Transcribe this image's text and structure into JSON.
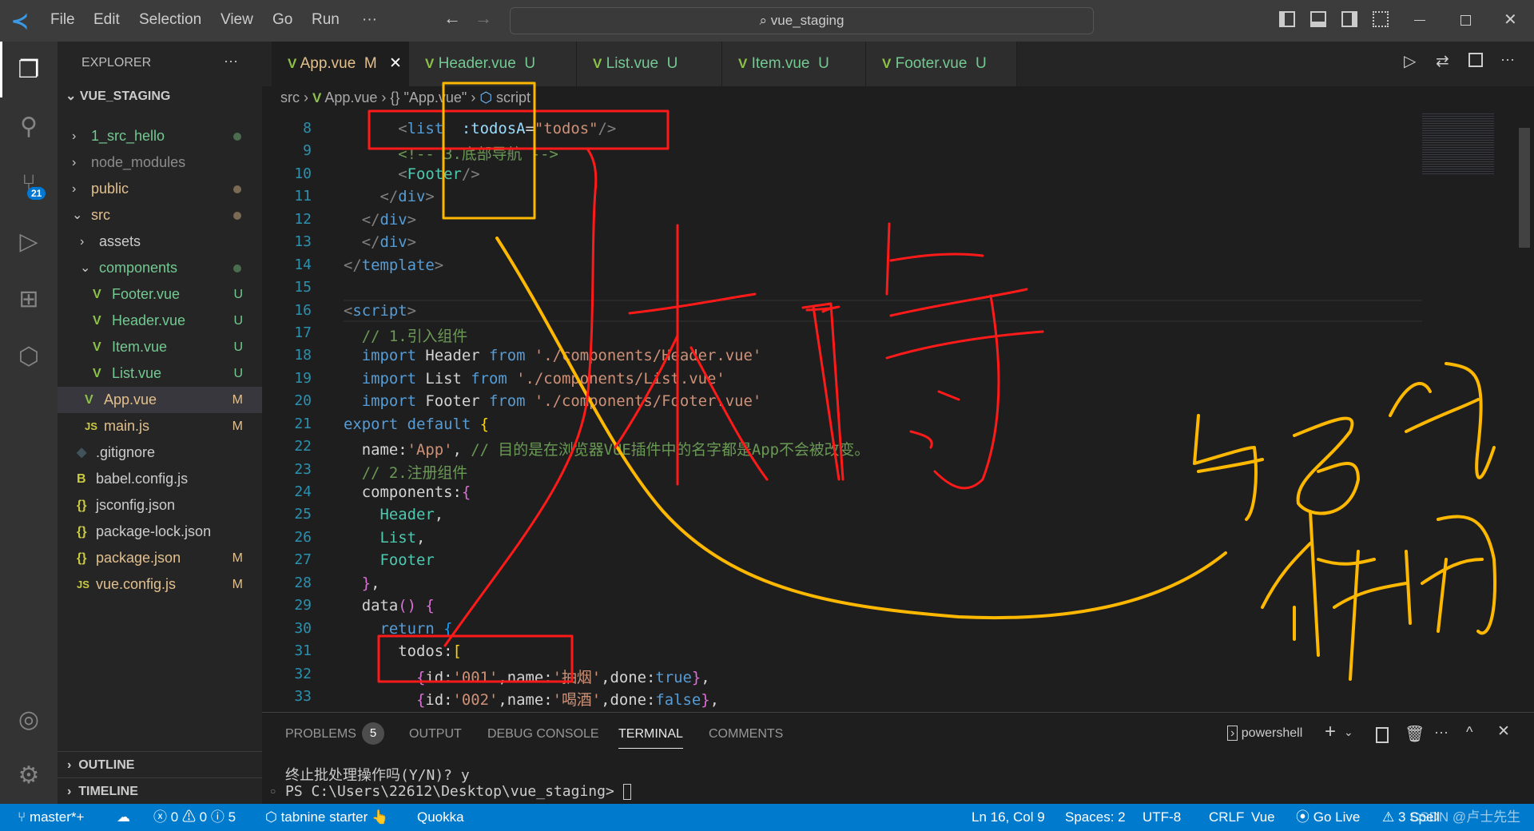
{
  "titlebar": {
    "menu": [
      "File",
      "Edit",
      "Selection",
      "View",
      "Go",
      "Run",
      "···"
    ],
    "search": "vue_staging",
    "back": "←",
    "forward": "→"
  },
  "activity": {
    "scm_badge": "21"
  },
  "sidebar": {
    "title": "EXPLORER",
    "more": "···",
    "root": "VUE_STAGING",
    "items": [
      {
        "label": "1_src_hello",
        "chev": "›",
        "depth": 0,
        "color": "#73c991",
        "dot": "#4b6c4f",
        "status": ""
      },
      {
        "label": "node_modules",
        "chev": "›",
        "depth": 0,
        "color": "#8c8c8c",
        "dot": "",
        "status": ""
      },
      {
        "label": "public",
        "chev": "›",
        "depth": 0,
        "color": "#e2c08d",
        "dot": "#7a6a53",
        "status": ""
      },
      {
        "label": "src",
        "chev": "⌄",
        "depth": 0,
        "color": "#e2c08d",
        "dot": "#7a6a53",
        "status": ""
      },
      {
        "label": "assets",
        "chev": "›",
        "depth": 1,
        "color": "#cccccc",
        "dot": "",
        "status": ""
      },
      {
        "label": "components",
        "chev": "⌄",
        "depth": 1,
        "color": "#73c991",
        "dot": "#4b6c4f",
        "status": ""
      },
      {
        "label": "Footer.vue",
        "icon": "V",
        "depth": 2,
        "color": "#73c991",
        "status": "U"
      },
      {
        "label": "Header.vue",
        "icon": "V",
        "depth": 2,
        "color": "#73c991",
        "status": "U"
      },
      {
        "label": "Item.vue",
        "icon": "V",
        "depth": 2,
        "color": "#73c991",
        "status": "U"
      },
      {
        "label": "List.vue",
        "icon": "V",
        "depth": 2,
        "color": "#73c991",
        "status": "U"
      },
      {
        "label": "App.vue",
        "icon": "V",
        "depth": 1,
        "color": "#e2c08d",
        "status": "M",
        "selected": true
      },
      {
        "label": "main.js",
        "icon": "JS",
        "depth": 1,
        "color": "#e2c08d",
        "status": "M"
      },
      {
        "label": ".gitignore",
        "icon": "◆",
        "depth": 0,
        "color": "#cccccc",
        "status": ""
      },
      {
        "label": "babel.config.js",
        "icon": "B",
        "depth": 0,
        "color": "#cccccc",
        "status": ""
      },
      {
        "label": "jsconfig.json",
        "icon": "{}",
        "depth": 0,
        "color": "#cccccc",
        "status": ""
      },
      {
        "label": "package-lock.json",
        "icon": "{}",
        "depth": 0,
        "color": "#cccccc",
        "status": ""
      },
      {
        "label": "package.json",
        "icon": "{}",
        "depth": 0,
        "color": "#e2c08d",
        "status": "M"
      },
      {
        "label": "vue.config.js",
        "icon": "JS",
        "depth": 0,
        "color": "#e2c08d",
        "status": "M"
      }
    ],
    "outline": "OUTLINE",
    "timeline": "TIMELINE"
  },
  "tabs": [
    {
      "label": "App.vue",
      "status": "M",
      "active": true
    },
    {
      "label": "Header.vue",
      "status": "U"
    },
    {
      "label": "List.vue",
      "status": "U"
    },
    {
      "label": "Item.vue",
      "status": "U"
    },
    {
      "label": "Footer.vue",
      "status": "U"
    }
  ],
  "breadcrumb": [
    "src",
    "App.vue",
    "\"App.vue\"",
    "script"
  ],
  "editor": {
    "first_line": 8,
    "lines": [
      [
        [
          "      ",
          "t-txt"
        ],
        [
          "<",
          "t-tag"
        ],
        [
          "list",
          "t-name"
        ],
        [
          "  :todosA",
          "t-attr"
        ],
        [
          "=",
          "t-txt"
        ],
        [
          "\"todos\"",
          "t-str"
        ],
        [
          "/>",
          "t-tag"
        ]
      ],
      [
        [
          "      ",
          "t-txt"
        ],
        [
          "<!-- 3.底部导航 -->",
          "t-com"
        ]
      ],
      [
        [
          "      ",
          "t-txt"
        ],
        [
          "<",
          "t-tag"
        ],
        [
          "Footer",
          "t-cmp"
        ],
        [
          "/>",
          "t-tag"
        ]
      ],
      [
        [
          "    ",
          "t-txt"
        ],
        [
          "</",
          "t-tag"
        ],
        [
          "div",
          "t-name"
        ],
        [
          ">",
          "t-tag"
        ]
      ],
      [
        [
          "  ",
          "t-txt"
        ],
        [
          "</",
          "t-tag"
        ],
        [
          "div",
          "t-name"
        ],
        [
          ">",
          "t-tag"
        ]
      ],
      [
        [
          "  ",
          "t-txt"
        ],
        [
          "</",
          "t-tag"
        ],
        [
          "div",
          "t-name"
        ],
        [
          ">",
          "t-tag"
        ]
      ],
      [
        [
          "</",
          "t-tag"
        ],
        [
          "template",
          "t-name"
        ],
        [
          ">",
          "t-tag"
        ]
      ],
      [
        [
          "",
          "t-txt"
        ]
      ],
      [
        [
          "<",
          "t-tag"
        ],
        [
          "script",
          "t-name"
        ],
        [
          ">",
          "t-tag"
        ]
      ],
      [
        [
          "  ",
          "t-txt"
        ],
        [
          "// 1.引入组件",
          "t-com"
        ]
      ],
      [
        [
          "  ",
          "t-txt"
        ],
        [
          "import",
          "t-kw"
        ],
        [
          " Header ",
          "t-id"
        ],
        [
          "from",
          "t-kw"
        ],
        [
          " './components/Header.vue'",
          "t-str"
        ]
      ],
      [
        [
          "  ",
          "t-txt"
        ],
        [
          "import",
          "t-kw"
        ],
        [
          " List ",
          "t-id"
        ],
        [
          "from",
          "t-kw"
        ],
        [
          " './components/List.vue'",
          "t-str"
        ]
      ],
      [
        [
          "  ",
          "t-txt"
        ],
        [
          "import",
          "t-kw"
        ],
        [
          " Footer ",
          "t-id"
        ],
        [
          "from",
          "t-kw"
        ],
        [
          " './components/Footer.vue'",
          "t-str"
        ]
      ],
      [
        [
          "export default ",
          "t-kw"
        ],
        [
          "{",
          "t-br1"
        ]
      ],
      [
        [
          "  name:",
          "t-txt"
        ],
        [
          "'App'",
          "t-str"
        ],
        [
          ", ",
          "t-txt"
        ],
        [
          "// 目的是在浏览器VUE插件中的名字都是App不会被改变。",
          "t-com"
        ]
      ],
      [
        [
          "  ",
          "t-txt"
        ],
        [
          "// 2.注册组件",
          "t-com"
        ]
      ],
      [
        [
          "  components:",
          "t-txt"
        ],
        [
          "{",
          "t-br2"
        ]
      ],
      [
        [
          "    ",
          "t-txt"
        ],
        [
          "Header",
          "t-cmp"
        ],
        [
          ",",
          "t-txt"
        ]
      ],
      [
        [
          "    ",
          "t-txt"
        ],
        [
          "List",
          "t-cmp"
        ],
        [
          ",",
          "t-txt"
        ]
      ],
      [
        [
          "    ",
          "t-txt"
        ],
        [
          "Footer",
          "t-cmp"
        ]
      ],
      [
        [
          "  ",
          "t-txt"
        ],
        [
          "}",
          "t-br2"
        ],
        [
          ",",
          "t-txt"
        ]
      ],
      [
        [
          "  data",
          "t-txt"
        ],
        [
          "()",
          "t-br2"
        ],
        [
          " ",
          "t-txt"
        ],
        [
          "{",
          "t-br2"
        ]
      ],
      [
        [
          "    ",
          "t-txt"
        ],
        [
          "return",
          "t-kw"
        ],
        [
          " ",
          "t-txt"
        ],
        [
          "{",
          "t-br3"
        ]
      ],
      [
        [
          "      todos:",
          "t-txt"
        ],
        [
          "[",
          "t-br1"
        ]
      ],
      [
        [
          "        ",
          "t-txt"
        ],
        [
          "{",
          "t-br2"
        ],
        [
          "id:",
          "t-txt"
        ],
        [
          "'001'",
          "t-str"
        ],
        [
          ",name:",
          "t-txt"
        ],
        [
          "'抽烟'",
          "t-str"
        ],
        [
          ",done:",
          "t-txt"
        ],
        [
          "true",
          "t-kw"
        ],
        [
          "}",
          "t-br2"
        ],
        [
          ",",
          "t-txt"
        ]
      ],
      [
        [
          "        ",
          "t-txt"
        ],
        [
          "{",
          "t-br2"
        ],
        [
          "id:",
          "t-txt"
        ],
        [
          "'002'",
          "t-str"
        ],
        [
          ",name:",
          "t-txt"
        ],
        [
          "'喝酒'",
          "t-str"
        ],
        [
          ",done:",
          "t-txt"
        ],
        [
          "false",
          "t-kw"
        ],
        [
          "}",
          "t-br2"
        ],
        [
          ",",
          "t-txt"
        ]
      ]
    ]
  },
  "panel": {
    "tabs": [
      "PROBLEMS",
      "OUTPUT",
      "DEBUG CONSOLE",
      "TERMINAL",
      "COMMENTS"
    ],
    "problems_count": "5",
    "active": "TERMINAL",
    "shell": "powershell",
    "terminal": [
      "终止批处理操作吗(Y/N)? y",
      "PS C:\\Users\\22612\\Desktop\\vue_staging> "
    ]
  },
  "statusbar": {
    "branch": "master*+",
    "errors": "0",
    "warnings": "0",
    "info": "5",
    "tabnine": "tabnine starter",
    "quokka": "Quokka",
    "position": "Ln 16, Col 9",
    "spaces": "Spaces: 2",
    "encoding": "UTF-8",
    "eol": "CRLF",
    "language": "Vue",
    "golive": "Go Live",
    "spell": "3 Spell",
    "watermark": "CSDN @卢士先生"
  },
  "colors": {
    "statusbar": "#007acc",
    "annotation_red": "#ff1a1a",
    "annotation_yellow": "#ffb800"
  }
}
